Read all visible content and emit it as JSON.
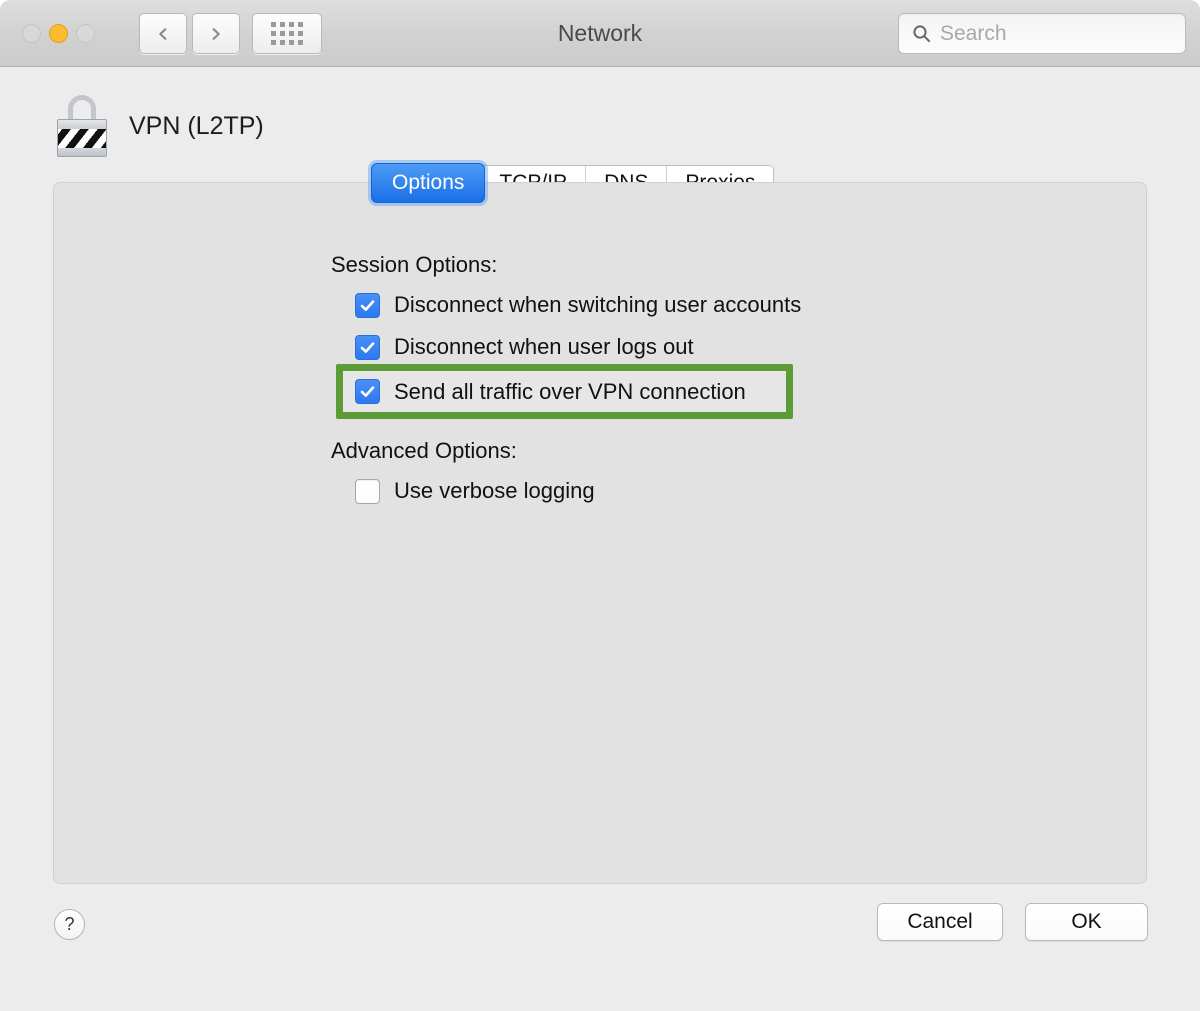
{
  "window": {
    "title": "Network",
    "traffic_lights": [
      {
        "name": "close",
        "state": "inactive"
      },
      {
        "name": "minimize",
        "state": "active-yellow"
      },
      {
        "name": "zoom",
        "state": "inactive"
      }
    ],
    "toolbar": {
      "back_icon": "chevron-left-icon",
      "forward_icon": "chevron-right-icon",
      "show_all_icon": "grid-icon"
    },
    "search": {
      "placeholder": "Search",
      "value": "",
      "icon": "search-icon"
    }
  },
  "header": {
    "service_name": "VPN (L2TP)",
    "icon": "lock-icon"
  },
  "tabs": [
    {
      "label": "Options",
      "selected": true
    },
    {
      "label": "TCP/IP",
      "selected": false
    },
    {
      "label": "DNS",
      "selected": false
    },
    {
      "label": "Proxies",
      "selected": false
    }
  ],
  "sections": {
    "session": {
      "label": "Session Options:",
      "options": [
        {
          "label": "Disconnect when switching user accounts",
          "checked": true,
          "highlighted": false
        },
        {
          "label": "Disconnect when user logs out",
          "checked": true,
          "highlighted": false
        },
        {
          "label": "Send all traffic over VPN connection",
          "checked": true,
          "highlighted": true
        }
      ]
    },
    "advanced": {
      "label": "Advanced Options:",
      "options": [
        {
          "label": "Use verbose logging",
          "checked": false,
          "highlighted": false
        }
      ]
    }
  },
  "footer": {
    "help_label": "?",
    "cancel_label": "Cancel",
    "ok_label": "OK"
  },
  "colors": {
    "accent_blue": "#2d78f2",
    "highlight_green": "#5d9b36",
    "window_bg": "#ececec",
    "panel_bg": "#e2e2e2",
    "minimize_yellow": "#fbbd2e"
  }
}
